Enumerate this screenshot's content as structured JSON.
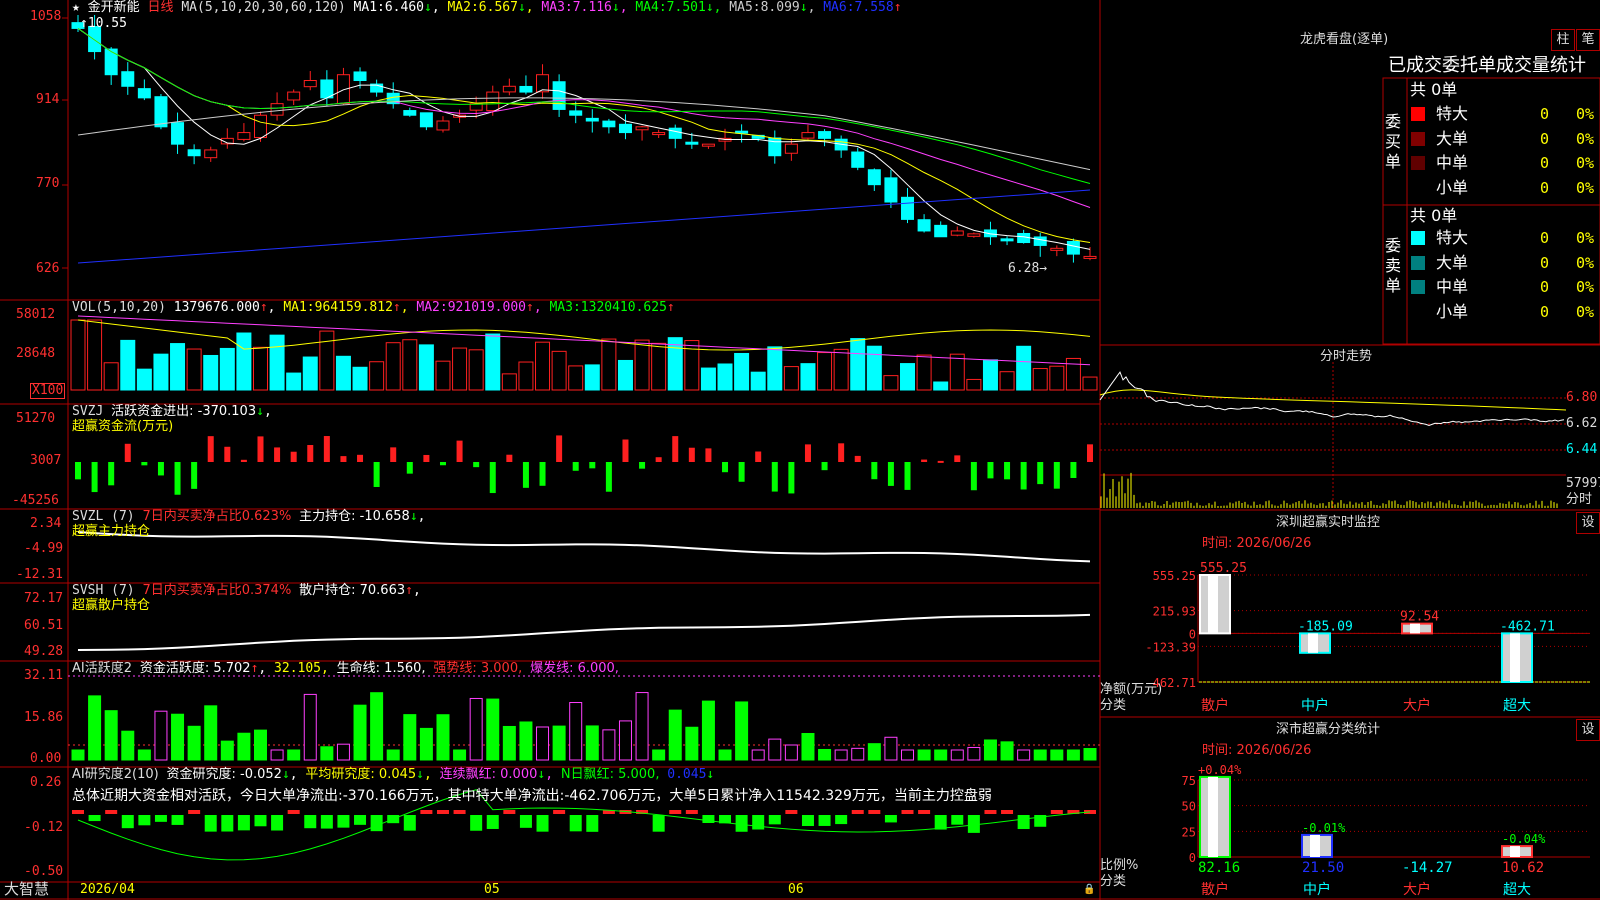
{
  "colors": {
    "up": "#ff2020",
    "down": "#00ffff",
    "grid": "#b00000",
    "text": "#dddddd",
    "ma1": "#ffffff",
    "ma2": "#ffff00",
    "ma3": "#ff40ff",
    "ma4": "#00ff00",
    "ma5": "#cccccc",
    "ma6": "#2030ff"
  },
  "main": {
    "stock_name": "金开新能",
    "period": "日线",
    "ma_label": "MA(5,10,20,30,60,120)",
    "ma_values": [
      {
        "label": "MA1:",
        "value": "6.460",
        "arrow": "↓"
      },
      {
        "label": "MA2:",
        "value": "6.567",
        "arrow": "↓"
      },
      {
        "label": "MA3:",
        "value": "7.116",
        "arrow": "↓"
      },
      {
        "label": "MA4:",
        "value": "7.501",
        "arrow": "↓"
      },
      {
        "label": "MA5:",
        "value": "8.099",
        "arrow": "↓"
      },
      {
        "label": "MA6:",
        "value": "7.558",
        "arrow": "↑"
      }
    ],
    "y_ticks": [
      "1058",
      "914",
      "770",
      "626"
    ],
    "high_label": "10.55",
    "low_label": "6.28→"
  },
  "vol": {
    "header": "VOL(5,10,20)",
    "value": "1379676.000",
    "ma": [
      {
        "label": "MA1:",
        "value": "964159.812"
      },
      {
        "label": "MA2:",
        "value": "921019.000"
      },
      {
        "label": "MA3:",
        "value": "1320410.625"
      }
    ],
    "y_ticks": [
      "58012",
      "28648"
    ],
    "unit": "X100"
  },
  "svzj": {
    "header": "SVZJ",
    "line1": "活跃资金进出: -370.103",
    "line2": "超赢资金流(万元)",
    "y_ticks": [
      "51270",
      "3007",
      "-45256"
    ]
  },
  "svzl": {
    "header": "SVZL (7)",
    "ratio": "7日内买卖净占比0.623%",
    "main": "主力持仓: -10.658",
    "line2": "超赢主力持仓",
    "y_ticks": [
      "2.34",
      "-4.99",
      "-12.31"
    ]
  },
  "svsh": {
    "header": "SVSH (7)",
    "ratio": "7日内买卖净占比0.374%",
    "main": "散户持仓: 70.663",
    "line2": "超赢散户持仓",
    "y_ticks": [
      "72.17",
      "60.51",
      "49.28"
    ]
  },
  "ai1": {
    "header": "AI活跃度2",
    "text": "资金活跃度: 5.702",
    "v2": "32.105,",
    "life": "生命线: 1.560,",
    "strong": "强势线: 3.000,",
    "burst": "爆发线: 6.000,",
    "y_ticks": [
      "32.11",
      "15.86",
      "0.00"
    ]
  },
  "ai2": {
    "header": "AI研究度2(10)",
    "text": "资金研究度: -0.052",
    "avg": "平均研究度: 0.045",
    "red": "连续飘红: 0.000",
    "nred": "N日飘红: 5.000,",
    "last": "0.045",
    "summary": "总体近期大资金相对活跃，今日大单净流出:-370.166万元，其中特大单净流出:-462.706万元，大单5日累计净入11542.329万元，当前主力控盘弱",
    "y_ticks": [
      "0.26",
      "-0.12",
      "-0.50"
    ]
  },
  "xaxis": {
    "labels": [
      "2026/04",
      "05",
      "06"
    ]
  },
  "brand": "大智慧",
  "right": {
    "title": "龙虎看盘(逐单)",
    "btn1": "柱",
    "btn2": "笔",
    "table_title": "已成交委托单成交量统计",
    "buy_side": "委买单",
    "sell_side": "委卖单",
    "buy_total": "共 0单",
    "sell_total": "共 0单",
    "rows": [
      {
        "label": "特大",
        "value": "0",
        "pct": "0%"
      },
      {
        "label": "大单",
        "value": "0",
        "pct": "0%"
      },
      {
        "label": "中单",
        "value": "0",
        "pct": "0%"
      },
      {
        "label": "小单",
        "value": "0",
        "pct": "0%"
      }
    ],
    "intraday_title": "分时走势",
    "intraday_ticks": [
      "6.80",
      "6.62",
      "6.44"
    ],
    "intraday_vol": "57997",
    "intraday_vol2": "分时",
    "sz_title": "深圳超赢实时监控",
    "set": "设",
    "sz_time": "时间: 2026/06/26",
    "sz_yticks": [
      "555.25",
      "215.93",
      "0",
      "-123.39",
      "-462.71"
    ],
    "sz_ylabel": "净额(万元)",
    "sz_xlabel": "分类",
    "sz_bars": [
      {
        "cat": "散户",
        "value": 555.25,
        "label": "555.25"
      },
      {
        "cat": "中户",
        "value": -185.09,
        "label": "-185.09"
      },
      {
        "cat": "大户",
        "value": 92.54,
        "label": "92.54"
      },
      {
        "cat": "超大",
        "value": -462.71,
        "label": "-462.71"
      }
    ],
    "sc_title": "深市超赢分类统计",
    "sc_time": "时间: 2026/06/26",
    "sc_yticks": [
      "75",
      "50",
      "25",
      "0"
    ],
    "sc_ylabel": "比例%",
    "sc_xlabel": "分类",
    "sc_bars": [
      {
        "cat": "散户",
        "value": 82.16,
        "pct": "+0.04%",
        "label": "82.16"
      },
      {
        "cat": "中户",
        "value": 21.5,
        "pct": "-0.01%",
        "label": "21.50"
      },
      {
        "cat": "大户",
        "value": -14.27,
        "pct": "",
        "label": "-14.27"
      },
      {
        "cat": "超大",
        "value": 10.62,
        "pct": "-0.04%",
        "label": "10.62"
      }
    ]
  },
  "chart_data": [
    {
      "type": "bar",
      "title": "深圳超赢实时监控",
      "ylabel": "净额(万元)",
      "xlabel": "分类",
      "categories": [
        "散户",
        "中户",
        "大户",
        "超大"
      ],
      "values": [
        555.25,
        -185.09,
        92.54,
        -462.71
      ],
      "ylim": [
        -462.71,
        555.25
      ]
    },
    {
      "type": "bar",
      "title": "深市超赢分类统计",
      "ylabel": "比例%",
      "xlabel": "分类",
      "categories": [
        "散户",
        "中户",
        "大户",
        "超大"
      ],
      "values": [
        82.16,
        21.5,
        -14.27,
        10.62
      ],
      "ylim": [
        0,
        75
      ]
    },
    {
      "type": "line",
      "title": "金开新能 日线",
      "series": [
        {
          "name": "MA1",
          "values": [
            6.46
          ]
        },
        {
          "name": "MA2",
          "values": [
            6.567
          ]
        },
        {
          "name": "MA3",
          "values": [
            7.116
          ]
        },
        {
          "name": "MA4",
          "values": [
            7.501
          ]
        },
        {
          "name": "MA5",
          "values": [
            8.099
          ]
        },
        {
          "name": "MA6",
          "values": [
            7.558
          ]
        }
      ]
    }
  ]
}
